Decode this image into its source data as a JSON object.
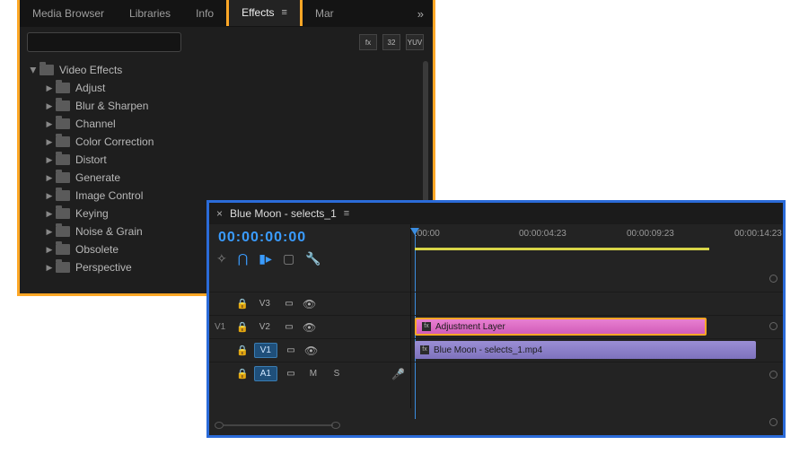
{
  "effects": {
    "tabs": [
      {
        "label": "Media Browser"
      },
      {
        "label": "Libraries"
      },
      {
        "label": "Info"
      },
      {
        "label": "Effects"
      },
      {
        "label": "Mar"
      }
    ],
    "active_tab": 3,
    "search_placeholder": "",
    "filter_icons": [
      "fx",
      "32",
      "YUV"
    ],
    "root": {
      "label": "Video Effects"
    },
    "folders": [
      {
        "label": "Adjust"
      },
      {
        "label": "Blur & Sharpen"
      },
      {
        "label": "Channel"
      },
      {
        "label": "Color Correction"
      },
      {
        "label": "Distort"
      },
      {
        "label": "Generate"
      },
      {
        "label": "Image Control"
      },
      {
        "label": "Keying"
      },
      {
        "label": "Noise & Grain"
      },
      {
        "label": "Obsolete"
      },
      {
        "label": "Perspective"
      }
    ]
  },
  "timeline": {
    "title": "Blue Moon - selects_1",
    "timecode": "00:00:00:00",
    "ruler": [
      ":00:00",
      "00:00:04:23",
      "00:00:09:23",
      "00:00:14:23"
    ],
    "tool_icons": [
      "insert-icon",
      "snap-icon",
      "marker-icon",
      "shield-icon",
      "wrench-icon"
    ],
    "tracks": {
      "v3": {
        "label": "V3"
      },
      "v2": {
        "label": "V2",
        "src": "V1"
      },
      "v1": {
        "label": "V1"
      },
      "a1": {
        "label": "A1",
        "m": "M",
        "s": "S"
      }
    },
    "clips": {
      "adjustment": {
        "label": "Adjustment Layer"
      },
      "video": {
        "label": "Blue Moon - selects_1.mp4"
      }
    }
  }
}
